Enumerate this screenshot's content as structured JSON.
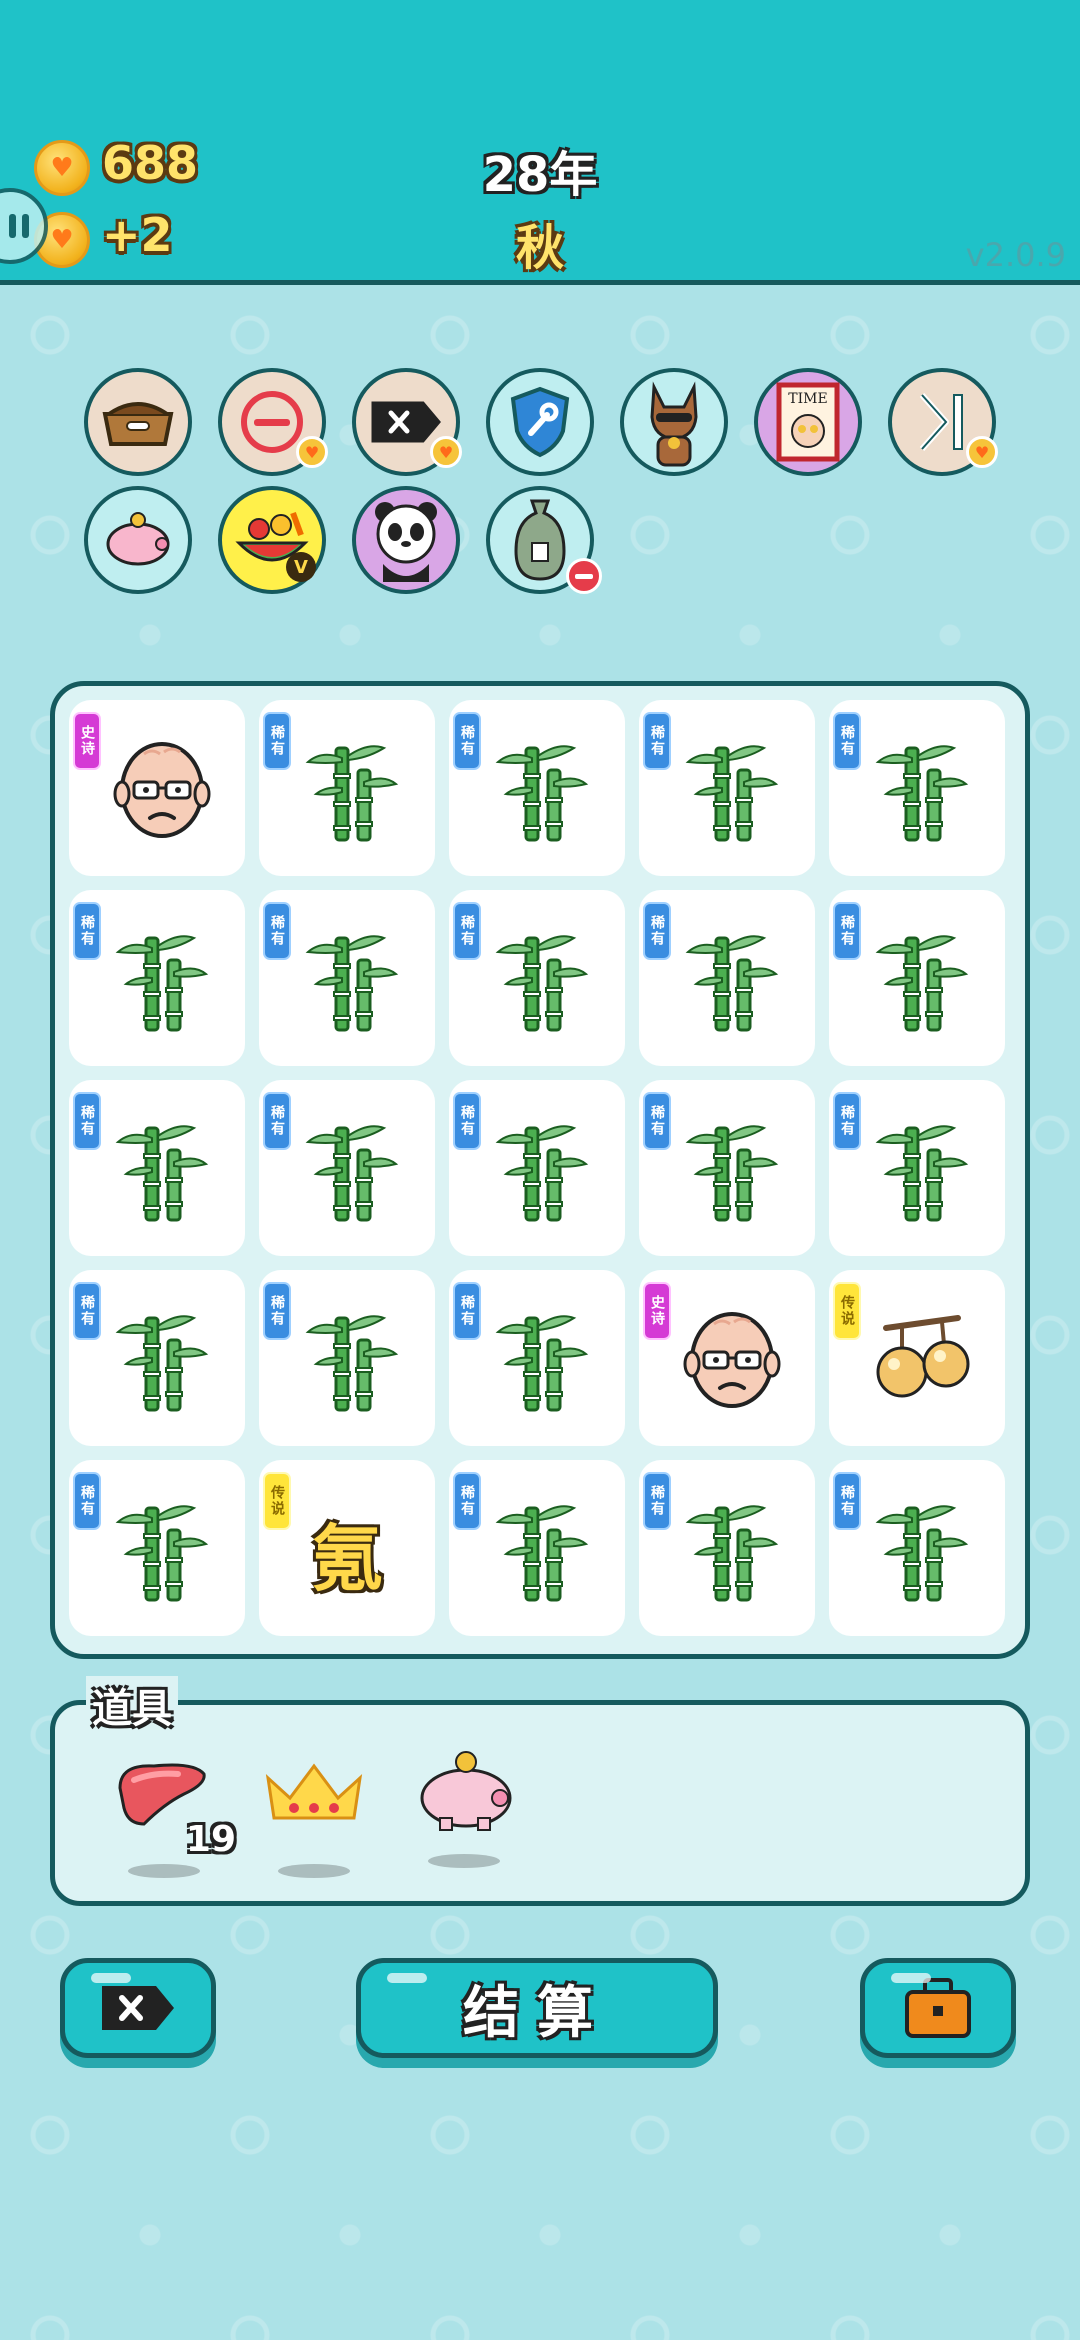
{
  "header": {
    "coins": "688",
    "coin_income": "+2",
    "year": "28年",
    "season": "秋",
    "version": "v2.0.9"
  },
  "effects": [
    {
      "name": "dog-food-bowl-icon",
      "bg": "#eedccb"
    },
    {
      "name": "remove-coin-icon",
      "bg": "#eedccb"
    },
    {
      "name": "delete-tag-icon",
      "bg": "#eedccb"
    },
    {
      "name": "wrench-shield-icon",
      "bg": "#bfeef0"
    },
    {
      "name": "shiba-dog-icon",
      "bg": "#bfeef0"
    },
    {
      "name": "time-magazine-icon",
      "bg": "#d9a6e6"
    },
    {
      "name": "skip-icon",
      "bg": "#eedccb"
    },
    {
      "name": "piggy-bank-icon",
      "bg": "#bfeef0"
    },
    {
      "name": "fruit-platter-icon",
      "bg": "#fff04a"
    },
    {
      "name": "panda-icon",
      "bg": "#d9a6e6"
    },
    {
      "name": "sack-icon",
      "bg": "#bfeef0"
    }
  ],
  "rarity": {
    "rare": "稀有",
    "epic": "史诗",
    "legend": "传说"
  },
  "grid": [
    [
      "old-man",
      "bamboo",
      "bamboo",
      "bamboo",
      "bamboo"
    ],
    [
      "bamboo",
      "bamboo",
      "bamboo",
      "bamboo",
      "bamboo"
    ],
    [
      "bamboo",
      "bamboo",
      "bamboo",
      "bamboo",
      "bamboo"
    ],
    [
      "bamboo",
      "bamboo",
      "bamboo",
      "old-man",
      "gourds"
    ],
    [
      "bamboo",
      "element",
      "bamboo",
      "bamboo",
      "bamboo"
    ]
  ],
  "element_char": "氪",
  "items_panel": {
    "title": "道具",
    "items": [
      {
        "name": "liver-item",
        "count": "19"
      },
      {
        "name": "crown-item",
        "count": ""
      },
      {
        "name": "piggy-bank-item",
        "count": ""
      }
    ]
  },
  "buttons": {
    "settle_label": "结算"
  },
  "colors": {
    "header": "#1fc2c8",
    "outline": "#155a5e",
    "background": "#ace2e7"
  }
}
